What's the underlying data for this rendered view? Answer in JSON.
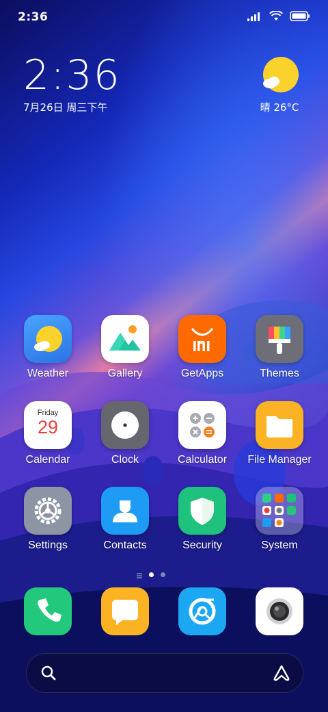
{
  "status_bar": {
    "time": "2:36"
  },
  "clock_widget": {
    "time": "2:36",
    "date": "7月26日 周三下午"
  },
  "weather_widget": {
    "text": "晴 26°C"
  },
  "apps": [
    {
      "label": "Weather",
      "icon": "weather-icon"
    },
    {
      "label": "Gallery",
      "icon": "gallery-icon"
    },
    {
      "label": "GetApps",
      "icon": "getapps-icon"
    },
    {
      "label": "Themes",
      "icon": "themes-icon"
    },
    {
      "label": "Calendar",
      "icon": "calendar-icon",
      "day": "Friday",
      "date": "29"
    },
    {
      "label": "Clock",
      "icon": "clock-icon"
    },
    {
      "label": "Calculator",
      "icon": "calculator-icon"
    },
    {
      "label": "File Manager",
      "icon": "file-manager-icon"
    },
    {
      "label": "Settings",
      "icon": "settings-icon"
    },
    {
      "label": "Contacts",
      "icon": "contacts-icon"
    },
    {
      "label": "Security",
      "icon": "security-icon"
    },
    {
      "label": "System",
      "icon": "folder-icon"
    }
  ],
  "dock": [
    {
      "icon": "phone-icon"
    },
    {
      "icon": "messages-icon"
    },
    {
      "icon": "browser-icon"
    },
    {
      "icon": "camera-icon"
    }
  ],
  "pager": {
    "current_page": 1,
    "page_count": 2
  },
  "colors": {
    "weather": "#3b8cf0",
    "getapps": "#ff6a00",
    "security": "#1fc27d",
    "contacts": "#1e9cf5",
    "filemanager": "#fbb324"
  }
}
